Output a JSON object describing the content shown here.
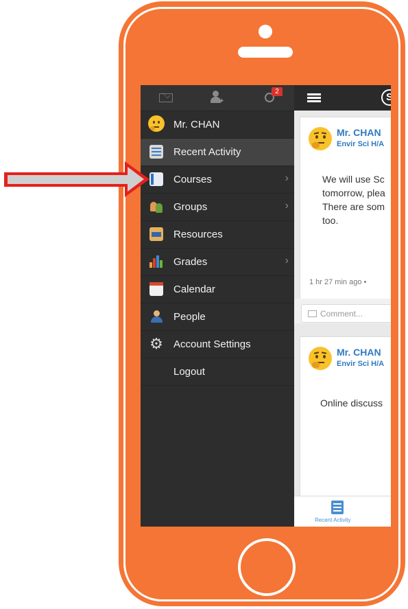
{
  "sidebar": {
    "notification_count": "2",
    "items": [
      {
        "label": "Mr. CHAN"
      },
      {
        "label": "Recent Activity"
      },
      {
        "label": "Courses"
      },
      {
        "label": "Groups"
      },
      {
        "label": "Resources"
      },
      {
        "label": "Grades"
      },
      {
        "label": "Calendar"
      },
      {
        "label": "People"
      },
      {
        "label": "Account Settings"
      },
      {
        "label": "Logout"
      }
    ]
  },
  "feed": {
    "posts": [
      {
        "author": "Mr. CHAN",
        "course": "Envir Sci H/A",
        "text": "We will use Sc\ntomorrow, plea\nThere are som\ntoo.",
        "timestamp": "1 hr 27 min ago",
        "comment_placeholder": "Comment..."
      },
      {
        "author": "Mr. CHAN",
        "course": "Envir Sci H/A",
        "text": "Online discuss"
      }
    ]
  },
  "bottom_tab": {
    "label": "Recent Activity"
  },
  "colors": {
    "phone": "#f47535",
    "sidebar": "#2d2d2d",
    "link": "#2f7ac0",
    "arrow": "#e4211c"
  }
}
